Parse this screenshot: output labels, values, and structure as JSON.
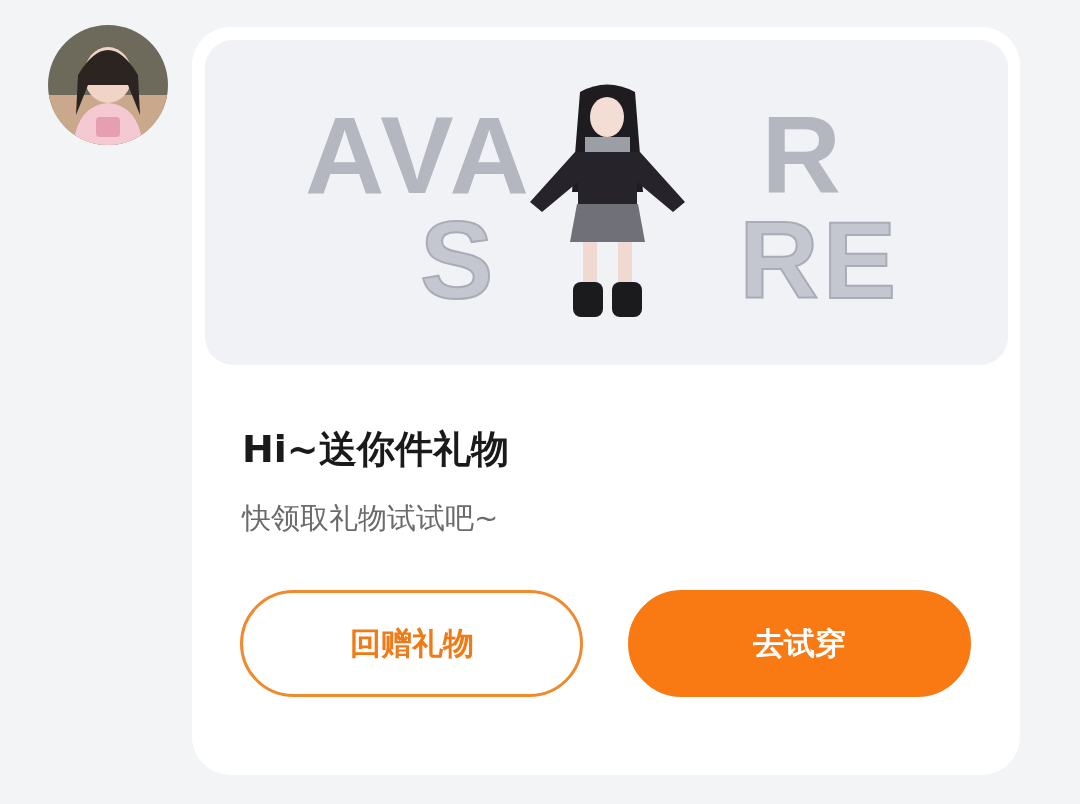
{
  "banner": {
    "backdrop_lines": [
      [
        "AVA",
        "R"
      ],
      [
        "S",
        "RE"
      ]
    ]
  },
  "title": "Hi~送你件礼物",
  "subtitle": "快领取礼物试试吧~",
  "buttons": [
    {
      "label": "回赠礼物",
      "kind": "outline"
    },
    {
      "label": "去试穿",
      "kind": "filled"
    }
  ]
}
